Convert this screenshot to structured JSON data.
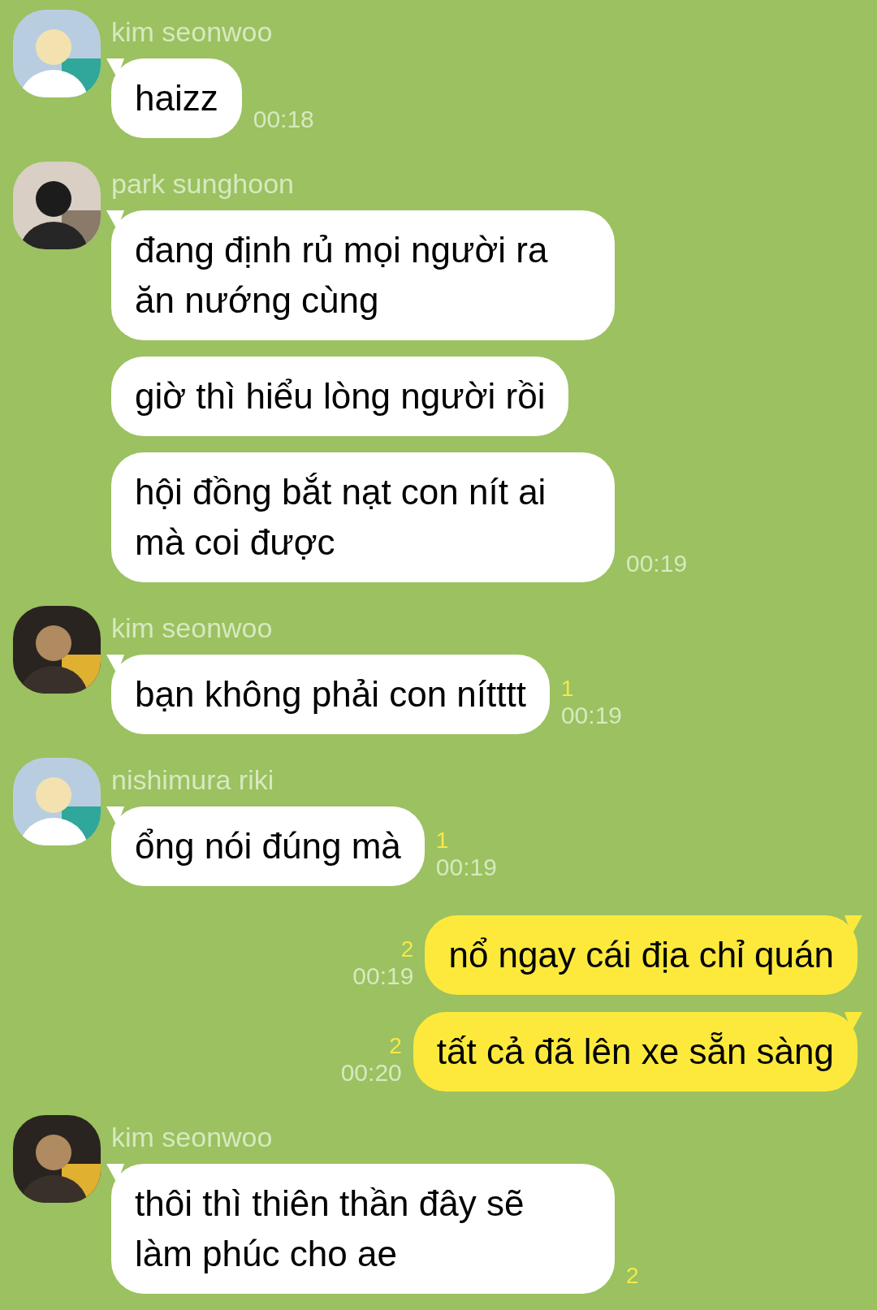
{
  "messages": [
    {
      "kind": "received",
      "sender": "kim seonwoo",
      "items": [
        {
          "text": "haizz",
          "tail": true,
          "time": "00:18"
        }
      ]
    },
    {
      "kind": "received",
      "sender": "park sunghoon",
      "items": [
        {
          "text": "đang định rủ mọi người ra ăn nướng cùng",
          "tail": true
        },
        {
          "text": "giờ thì hiểu lòng người rồi",
          "tail": false
        },
        {
          "text": "hội đồng bắt nạt con nít ai mà coi được",
          "tail": false,
          "time": "00:19"
        }
      ]
    },
    {
      "kind": "received",
      "sender": "kim seonwoo",
      "items": [
        {
          "text": "bạn không phải con nítttt",
          "tail": true,
          "unread": "1",
          "time": "00:19"
        }
      ]
    },
    {
      "kind": "received",
      "sender": "nishimura riki",
      "items": [
        {
          "text": "ổng nói đúng mà",
          "tail": true,
          "unread": "1",
          "time": "00:19"
        }
      ]
    },
    {
      "kind": "sent",
      "items": [
        {
          "text": "nổ ngay cái địa chỉ quán",
          "tail": true,
          "unread": "2",
          "time": "00:19"
        },
        {
          "text": "tất cả đã lên xe sẵn sàng",
          "tail": true,
          "unread": "2",
          "time": "00:20"
        }
      ]
    },
    {
      "kind": "received",
      "sender": "kim seonwoo",
      "items": [
        {
          "text": "thôi thì thiên thần đây sẽ làm phúc cho ae",
          "tail": true,
          "unread": "2"
        }
      ]
    }
  ]
}
